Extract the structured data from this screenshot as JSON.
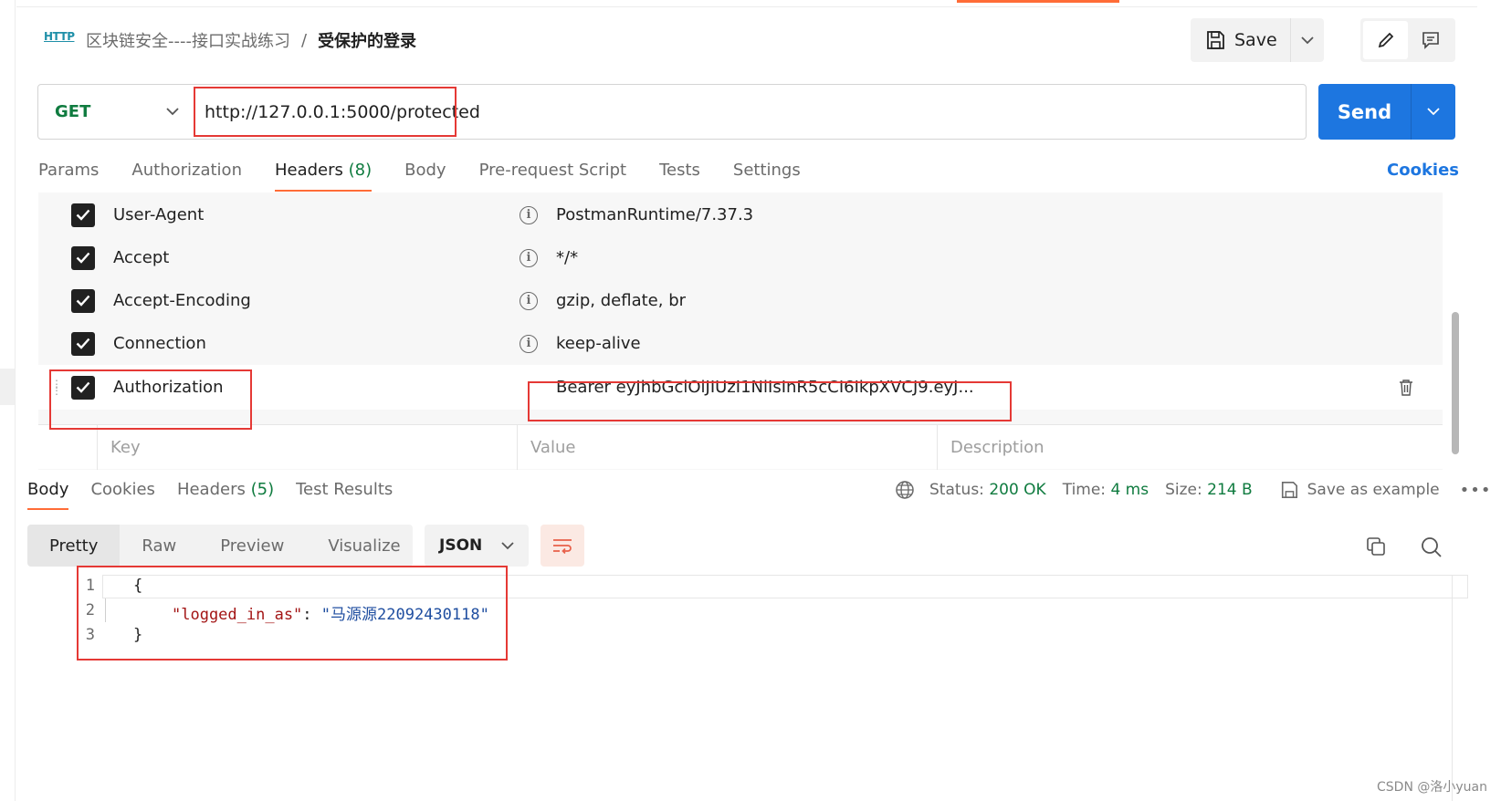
{
  "breadcrumb": {
    "protocol_badge": "HTTP",
    "collection": "区块链安全----接口实战练习",
    "separator": "/",
    "request_name": "受保护的登录"
  },
  "toolbar": {
    "save_label": "Save"
  },
  "request": {
    "method": "GET",
    "url": "http://127.0.0.1:5000/protected",
    "send_label": "Send"
  },
  "request_tabs": {
    "params": "Params",
    "authorization": "Authorization",
    "headers": "Headers",
    "headers_count": "(8)",
    "body": "Body",
    "pre_request": "Pre-request Script",
    "tests": "Tests",
    "settings": "Settings",
    "cookies": "Cookies"
  },
  "headers": [
    {
      "key": "User-Agent",
      "value": "PostmanRuntime/7.37.3",
      "checked": true
    },
    {
      "key": "Accept",
      "value": "*/*",
      "checked": true
    },
    {
      "key": "Accept-Encoding",
      "value": "gzip, deflate, br",
      "checked": true
    },
    {
      "key": "Connection",
      "value": "keep-alive",
      "checked": true
    },
    {
      "key": "Authorization",
      "value": "Bearer eyJhbGciOiJIUzI1NiIsInR5cCI6IkpXVCJ9.eyJ...",
      "checked": true
    }
  ],
  "headers_placeholder": {
    "key": "Key",
    "value": "Value",
    "description": "Description"
  },
  "response_tabs": {
    "body": "Body",
    "cookies": "Cookies",
    "headers": "Headers",
    "headers_count": "(5)",
    "test_results": "Test Results"
  },
  "response_status": {
    "status_label": "Status:",
    "status_value": "200 OK",
    "time_label": "Time:",
    "time_value": "4 ms",
    "size_label": "Size:",
    "size_value": "214 B",
    "save_example": "Save as example"
  },
  "view_options": {
    "pretty": "Pretty",
    "raw": "Raw",
    "preview": "Preview",
    "visualize": "Visualize",
    "format": "JSON"
  },
  "response_body": {
    "line_numbers": [
      "1",
      "2",
      "3"
    ],
    "open_brace": "{",
    "key": "\"logged_in_as\"",
    "colon": ": ",
    "value": "\"马源源22092430118\"",
    "close_brace": "}"
  },
  "watermark": "CSDN @洛小yuan",
  "colors": {
    "accent": "#ff6c37",
    "send": "#1d76e0",
    "method_get": "#0f7b3f",
    "highlight_box": "#e53935"
  }
}
